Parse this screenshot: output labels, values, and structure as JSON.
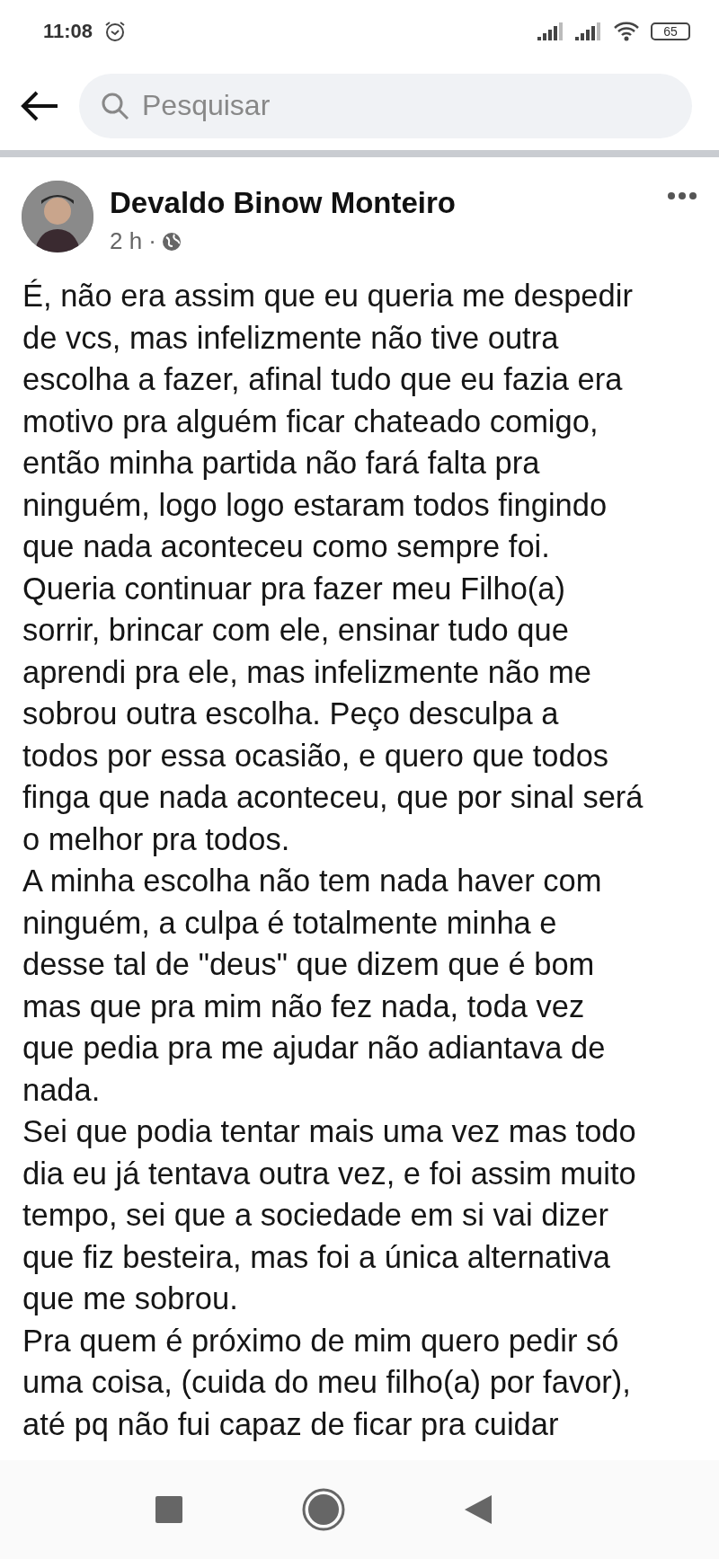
{
  "status_bar": {
    "time": "11:08",
    "battery": "65"
  },
  "search": {
    "placeholder": "Pesquisar"
  },
  "post": {
    "author": "Devaldo Binow Monteiro",
    "time": "2 h ·",
    "paragraphs": [
      [
        "É, não era assim que eu queria me despedir",
        "de vcs, mas infelizmente não tive outra",
        "escolha a fazer, afinal tudo que eu fazia era",
        "motivo pra alguém ficar chateado comigo,",
        "então minha partida não fará falta pra",
        "ninguém, logo logo estaram todos fingindo",
        "que nada aconteceu como sempre foi."
      ],
      [
        "Queria continuar pra fazer meu Filho(a)",
        "sorrir, brincar com ele, ensinar tudo que",
        "aprendi pra ele, mas infelizmente não me",
        "sobrou outra escolha. Peço desculpa a",
        "todos por essa ocasião, e quero que todos",
        "finga que nada aconteceu, que por sinal será",
        "o melhor pra todos."
      ],
      [
        "A minha escolha não tem nada haver com",
        "ninguém, a culpa é totalmente minha e",
        "desse tal de \"deus\" que dizem que é bom",
        "mas que pra mim não fez nada, toda vez",
        "que pedia pra me ajudar não adiantava de",
        "nada."
      ],
      [
        "Sei que podia tentar mais uma vez mas todo",
        "dia eu já tentava outra vez, e foi assim muito",
        "tempo, sei que a sociedade em si vai dizer",
        "que fiz besteira, mas foi a única alternativa",
        "que me sobrou."
      ],
      [
        "Pra quem é próximo de mim quero pedir só",
        "uma coisa, (cuida do meu filho(a) por favor),",
        "até pq não fui capaz de ficar pra cuidar"
      ]
    ]
  }
}
